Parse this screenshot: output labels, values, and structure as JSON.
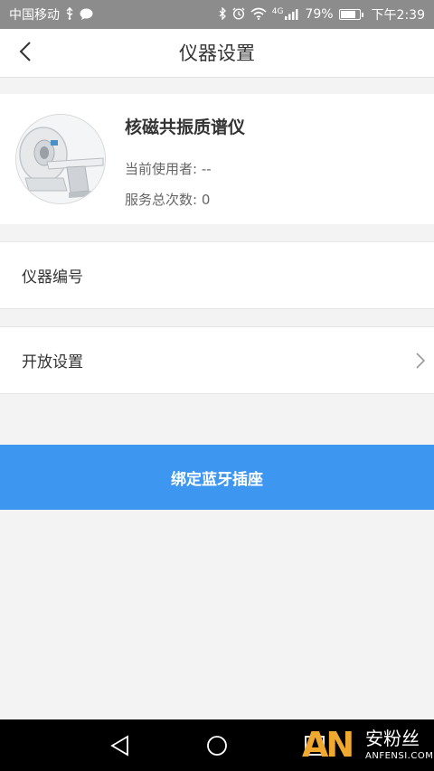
{
  "status_bar": {
    "carrier": "中国移动",
    "network": "4G",
    "battery": "79%",
    "time": "下午2:39",
    "icons": [
      "usb-icon",
      "chat-icon",
      "bluetooth-icon",
      "alarm-icon",
      "wifi-icon",
      "signal-icon",
      "battery-icon"
    ]
  },
  "header": {
    "title": "仪器设置",
    "back_icon": "chevron-left-icon"
  },
  "device": {
    "name": "核磁共振质谱仪",
    "current_user": "当前使用者: --",
    "service_count": "服务总次数: 0",
    "image": "nmr-instrument-photo"
  },
  "settings": {
    "serial_label": "仪器编号",
    "open_settings_label": "开放设置"
  },
  "actions": {
    "bind_label": "绑定蓝牙插座"
  },
  "system_nav": {
    "back": "back-triangle-icon",
    "home": "home-circle-icon",
    "recent": "recent-square-icon"
  },
  "watermark": {
    "logo": "AN",
    "cn": "安粉丝",
    "en": "ANFENSI.COM"
  },
  "colors": {
    "status_bar": "#8c8c8c",
    "primary": "#3d96f0",
    "background": "#f3f3f3",
    "watermark": "#f0a92e"
  }
}
